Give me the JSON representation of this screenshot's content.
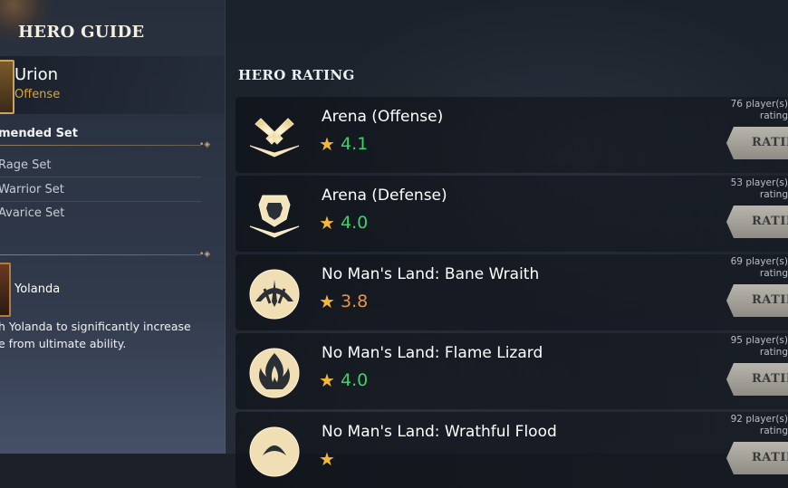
{
  "left_panel": {
    "title": "HERO GUIDE",
    "hero": {
      "name": "Urion",
      "role": "Offense"
    },
    "recommended_label": "mended Set",
    "sets": [
      "Rage Set",
      "Warrior Set",
      "Avarice Set"
    ],
    "partner": {
      "name": "Yolanda",
      "description": "h Yolanda to significantly increase\ne from ultimate ability."
    }
  },
  "rating": {
    "title": "HERO RATING",
    "button_label": "RATIN",
    "rows": [
      {
        "name": "Arena (Offense)",
        "score": "4.1",
        "score_color": "#3fd06a",
        "players": "76 player(s)",
        "players_sub": "rating",
        "icon": "crossed-swords-icon"
      },
      {
        "name": "Arena (Defense)",
        "score": "4.0",
        "score_color": "#3fd06a",
        "players": "53 player(s)",
        "players_sub": "rating",
        "icon": "shield-icon"
      },
      {
        "name": "No Man's Land: Bane Wraith",
        "score": "3.8",
        "score_color": "#e8954a",
        "players": "69 player(s)",
        "players_sub": "rating",
        "icon": "wraith-icon"
      },
      {
        "name": "No Man's Land: Flame Lizard",
        "score": "4.0",
        "score_color": "#3fd06a",
        "players": "95 player(s)",
        "players_sub": "rating",
        "icon": "flame-icon"
      },
      {
        "name": "No Man's Land: Wrathful Flood",
        "score": "",
        "score_color": "#3fd06a",
        "players": "92 player(s)",
        "players_sub": "rating",
        "icon": "flood-icon"
      }
    ]
  }
}
